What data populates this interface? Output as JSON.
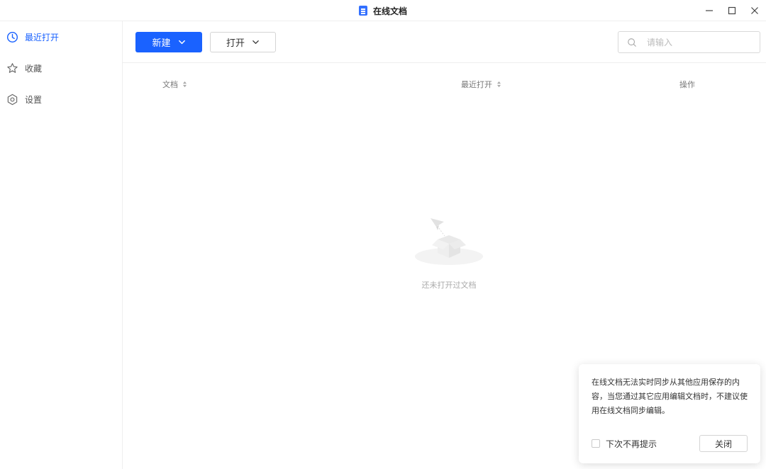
{
  "window": {
    "title": "在线文档",
    "controls": [
      "minimize-icon",
      "maximize-icon",
      "close-icon"
    ]
  },
  "sidebar": {
    "items": [
      {
        "label": "最近打开",
        "icon": "clock-icon",
        "active": true
      },
      {
        "label": "收藏",
        "icon": "star-icon",
        "active": false
      },
      {
        "label": "设置",
        "icon": "gear-icon",
        "active": false
      }
    ]
  },
  "toolbar": {
    "new_label": "新建",
    "open_label": "打开"
  },
  "search": {
    "placeholder": "请输入",
    "value": ""
  },
  "table": {
    "columns": [
      "文档",
      "最近打开",
      "操作"
    ]
  },
  "empty_state": {
    "text": "还未打开过文档"
  },
  "notice": {
    "message": "在线文档无法实时同步从其他应用保存的内容，当您通过其它应用编辑文档时，不建议使用在线文档同步编辑。",
    "checkbox_label": "下次不再提示",
    "close_label": "关闭"
  },
  "colors": {
    "accent": "#1a62ff",
    "border": "#eeeeee"
  }
}
